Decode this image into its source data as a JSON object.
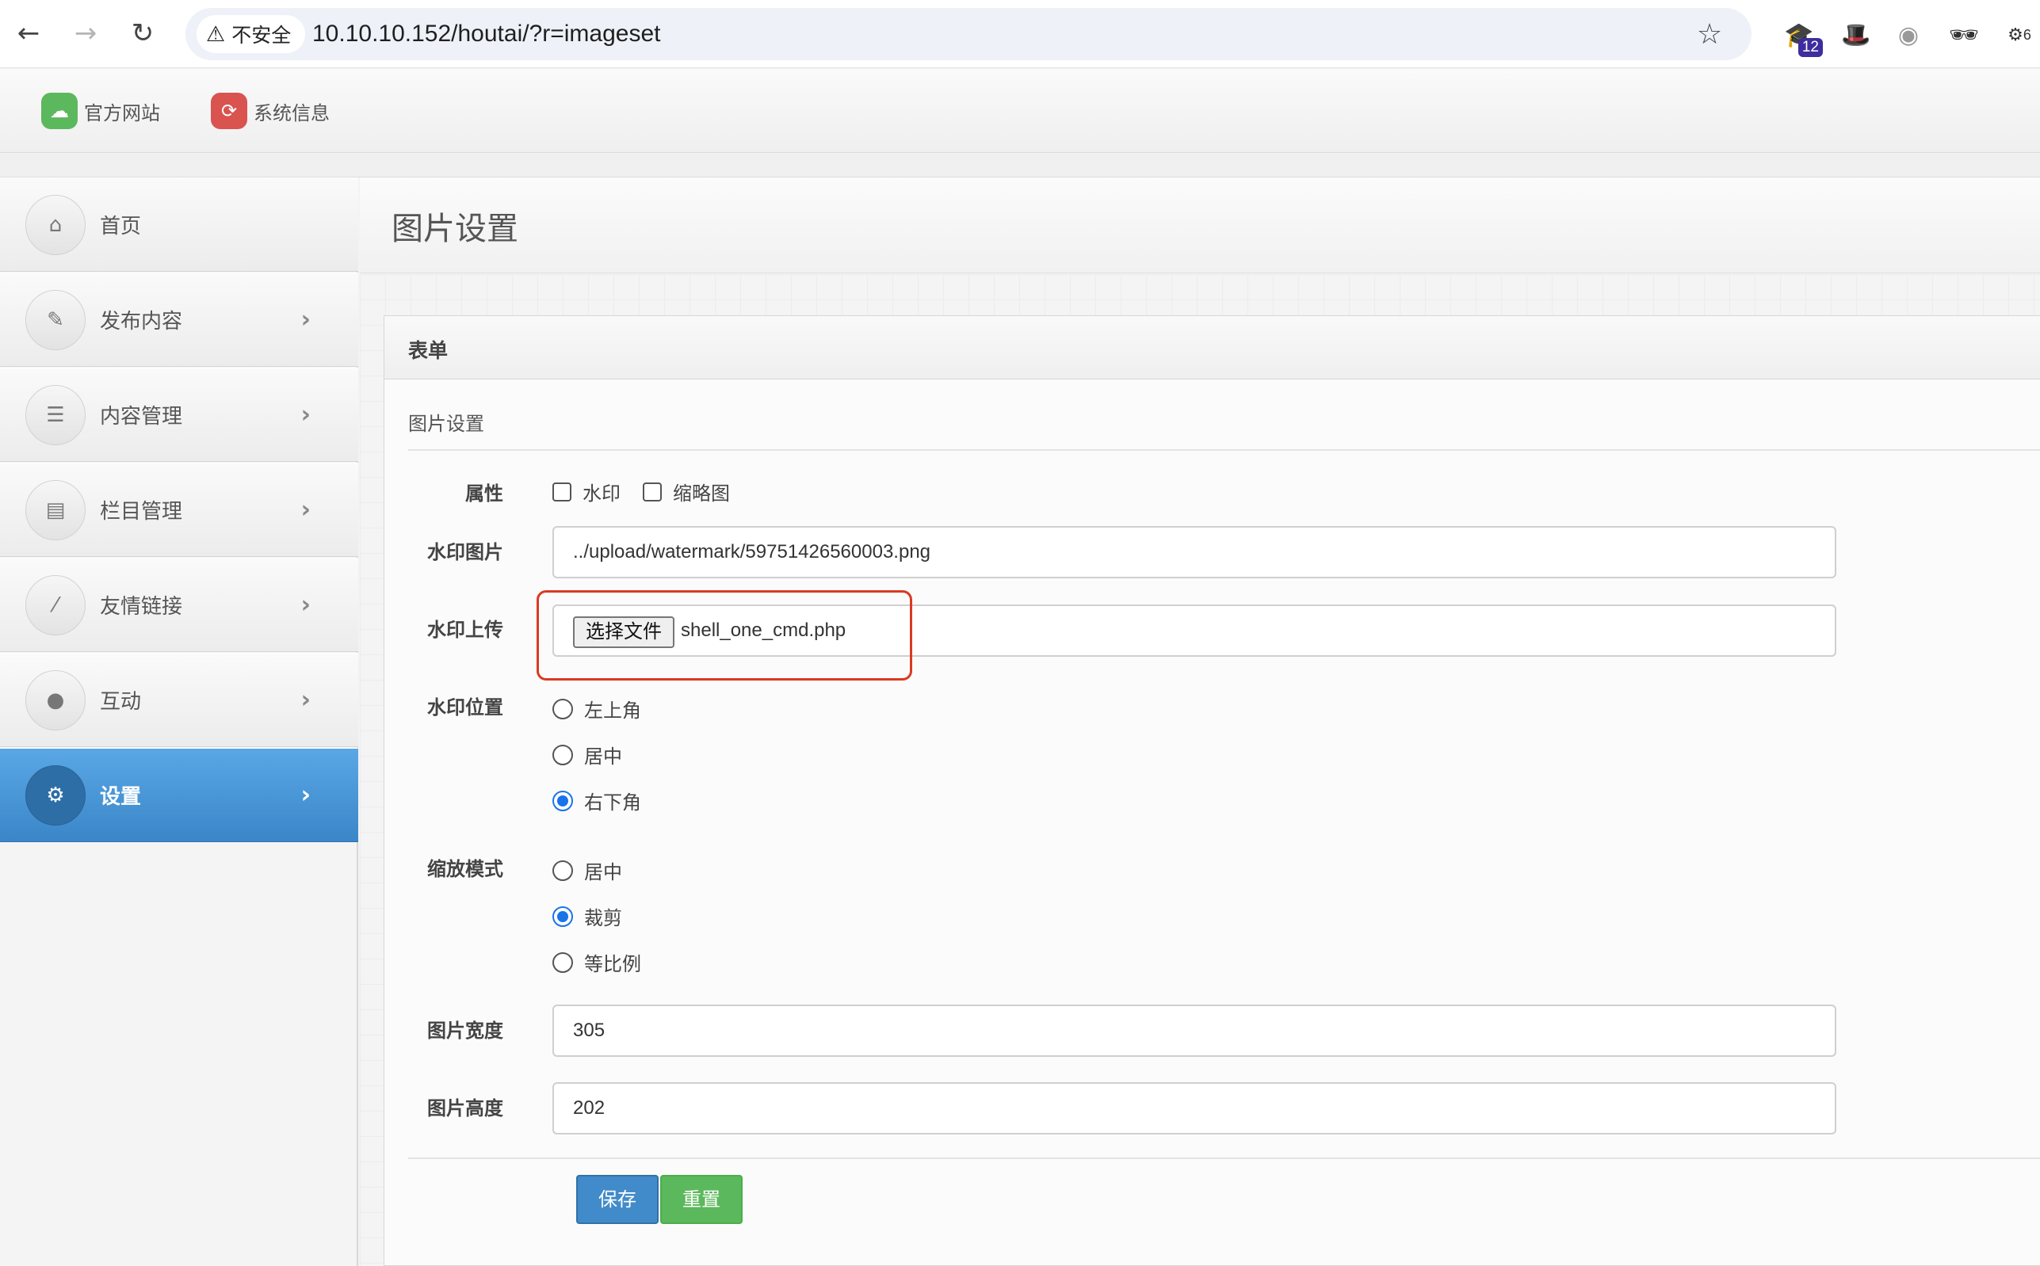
{
  "browser": {
    "security_label": "不安全",
    "url": "10.10.10.152/houtai/?r=imageset",
    "extension_badge": "12",
    "extension_count": "6"
  },
  "topbar": {
    "links": [
      {
        "label": "官方网站",
        "icon": "cloud-upload-icon",
        "color": "#5cb85c"
      },
      {
        "label": "系统信息",
        "icon": "refresh-icon",
        "color": "#d9534f"
      }
    ]
  },
  "sidebar": {
    "items": [
      {
        "label": "首页",
        "icon": "home-icon"
      },
      {
        "label": "发布内容",
        "icon": "pencil-icon"
      },
      {
        "label": "内容管理",
        "icon": "list-icon"
      },
      {
        "label": "栏目管理",
        "icon": "columns-icon"
      },
      {
        "label": "友情链接",
        "icon": "magic-wand-icon"
      },
      {
        "label": "互动",
        "icon": "comments-icon"
      },
      {
        "label": "设置",
        "icon": "cogs-icon",
        "active": true
      }
    ]
  },
  "page": {
    "title": "图片设置",
    "panel_title": "表单",
    "legend": "图片设置"
  },
  "form": {
    "attributes_label": "属性",
    "attr_watermark": "水印",
    "attr_thumbnail": "缩略图",
    "watermark_image_label": "水印图片",
    "watermark_image_value": "../upload/watermark/59751426560003.png",
    "watermark_upload_label": "水印上传",
    "file_button": "选择文件",
    "file_name": "shell_one_cmd.php",
    "watermark_position_label": "水印位置",
    "positions": [
      "左上角",
      "居中",
      "右下角"
    ],
    "position_selected": "右下角",
    "scale_mode_label": "缩放模式",
    "scale_modes": [
      "居中",
      "裁剪",
      "等比例"
    ],
    "scale_selected": "裁剪",
    "width_label": "图片宽度",
    "width_value": "305",
    "height_label": "图片高度",
    "height_value": "202",
    "save_button": "保存",
    "reset_button": "重置"
  }
}
